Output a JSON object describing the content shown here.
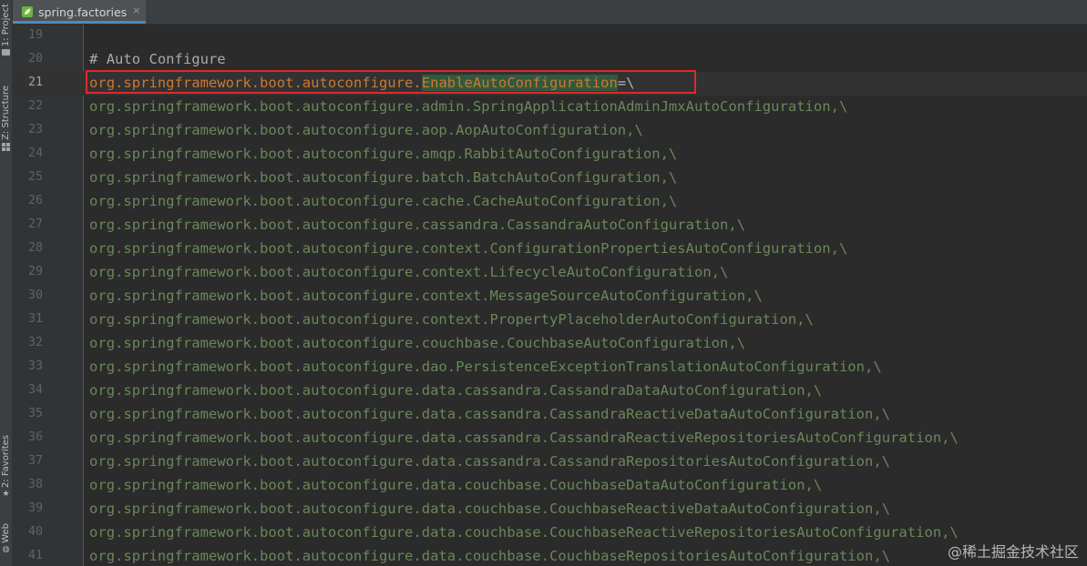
{
  "tool_windows": {
    "project_label": "1: Project",
    "structure_label": "Z: Structure",
    "favorites_label": "2: Favorites",
    "web_label": "Web"
  },
  "tab": {
    "title": "spring.factories",
    "close_glyph": "×",
    "icon": "spring-leaf-icon",
    "accent_color": "#4a88c7"
  },
  "editor": {
    "current_line": 21,
    "highlight_box_color": "#e0292b",
    "lines": [
      {
        "number": "19",
        "key": "",
        "enable": "",
        "rest": "",
        "comment": ""
      },
      {
        "number": "20",
        "key": "",
        "enable": "",
        "rest": "",
        "comment": "# Auto Configure"
      },
      {
        "number": "21",
        "key": "org.springframework.boot.autoconfigure.",
        "enable": "EnableAutoConfiguration",
        "rest": "=\\",
        "comment": ""
      },
      {
        "number": "22",
        "key": "",
        "enable": "",
        "rest": "org.springframework.boot.autoconfigure.admin.SpringApplicationAdminJmxAutoConfiguration,\\",
        "comment": ""
      },
      {
        "number": "23",
        "key": "",
        "enable": "",
        "rest": "org.springframework.boot.autoconfigure.aop.AopAutoConfiguration,\\",
        "comment": ""
      },
      {
        "number": "24",
        "key": "",
        "enable": "",
        "rest": "org.springframework.boot.autoconfigure.amqp.RabbitAutoConfiguration,\\",
        "comment": ""
      },
      {
        "number": "25",
        "key": "",
        "enable": "",
        "rest": "org.springframework.boot.autoconfigure.batch.BatchAutoConfiguration,\\",
        "comment": ""
      },
      {
        "number": "26",
        "key": "",
        "enable": "",
        "rest": "org.springframework.boot.autoconfigure.cache.CacheAutoConfiguration,\\",
        "comment": ""
      },
      {
        "number": "27",
        "key": "",
        "enable": "",
        "rest": "org.springframework.boot.autoconfigure.cassandra.CassandraAutoConfiguration,\\",
        "comment": ""
      },
      {
        "number": "28",
        "key": "",
        "enable": "",
        "rest": "org.springframework.boot.autoconfigure.context.ConfigurationPropertiesAutoConfiguration,\\",
        "comment": ""
      },
      {
        "number": "29",
        "key": "",
        "enable": "",
        "rest": "org.springframework.boot.autoconfigure.context.LifecycleAutoConfiguration,\\",
        "comment": ""
      },
      {
        "number": "30",
        "key": "",
        "enable": "",
        "rest": "org.springframework.boot.autoconfigure.context.MessageSourceAutoConfiguration,\\",
        "comment": ""
      },
      {
        "number": "31",
        "key": "",
        "enable": "",
        "rest": "org.springframework.boot.autoconfigure.context.PropertyPlaceholderAutoConfiguration,\\",
        "comment": ""
      },
      {
        "number": "32",
        "key": "",
        "enable": "",
        "rest": "org.springframework.boot.autoconfigure.couchbase.CouchbaseAutoConfiguration,\\",
        "comment": ""
      },
      {
        "number": "33",
        "key": "",
        "enable": "",
        "rest": "org.springframework.boot.autoconfigure.dao.PersistenceExceptionTranslationAutoConfiguration,\\",
        "comment": ""
      },
      {
        "number": "34",
        "key": "",
        "enable": "",
        "rest": "org.springframework.boot.autoconfigure.data.cassandra.CassandraDataAutoConfiguration,\\",
        "comment": ""
      },
      {
        "number": "35",
        "key": "",
        "enable": "",
        "rest": "org.springframework.boot.autoconfigure.data.cassandra.CassandraReactiveDataAutoConfiguration,\\",
        "comment": ""
      },
      {
        "number": "36",
        "key": "",
        "enable": "",
        "rest": "org.springframework.boot.autoconfigure.data.cassandra.CassandraReactiveRepositoriesAutoConfiguration,\\",
        "comment": ""
      },
      {
        "number": "37",
        "key": "",
        "enable": "",
        "rest": "org.springframework.boot.autoconfigure.data.cassandra.CassandraRepositoriesAutoConfiguration,\\",
        "comment": ""
      },
      {
        "number": "38",
        "key": "",
        "enable": "",
        "rest": "org.springframework.boot.autoconfigure.data.couchbase.CouchbaseDataAutoConfiguration,\\",
        "comment": ""
      },
      {
        "number": "39",
        "key": "",
        "enable": "",
        "rest": "org.springframework.boot.autoconfigure.data.couchbase.CouchbaseReactiveDataAutoConfiguration,\\",
        "comment": ""
      },
      {
        "number": "40",
        "key": "",
        "enable": "",
        "rest": "org.springframework.boot.autoconfigure.data.couchbase.CouchbaseReactiveRepositoriesAutoConfiguration,\\",
        "comment": ""
      },
      {
        "number": "41",
        "key": "",
        "enable": "",
        "rest": "org.springframework.boot.autoconfigure.data.couchbase.CouchbaseRepositoriesAutoConfiguration,\\",
        "comment": ""
      }
    ]
  },
  "watermark": "@稀土掘金技术社区"
}
